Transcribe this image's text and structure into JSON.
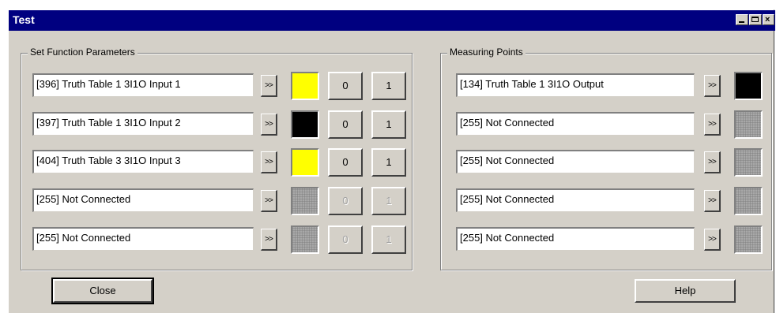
{
  "window": {
    "title": "Test",
    "controls": [
      "minimize-icon",
      "maximize-icon",
      "close-icon"
    ]
  },
  "colors": {
    "title_bar": "#000080",
    "yellow": "#ffff00",
    "black": "#000000"
  },
  "set_function": {
    "legend": "Set Function Parameters",
    "rows": [
      {
        "name": "[396] Truth Table 1 3I1O Input 1",
        "arrow": ">>",
        "state": "yellow",
        "btn0": "0",
        "btn1": "1",
        "enabled": true
      },
      {
        "name": "[397] Truth Table 1 3I1O Input 2",
        "arrow": ">>",
        "state": "black",
        "btn0": "0",
        "btn1": "1",
        "enabled": true
      },
      {
        "name": "[404] Truth Table 3 3I1O Input 3",
        "arrow": ">>",
        "state": "yellow",
        "btn0": "0",
        "btn1": "1",
        "enabled": true
      },
      {
        "name": "[255] Not Connected",
        "arrow": ">>",
        "state": "disabled",
        "btn0": "0",
        "btn1": "1",
        "enabled": false
      },
      {
        "name": "[255] Not Connected",
        "arrow": ">>",
        "state": "disabled",
        "btn0": "0",
        "btn1": "1",
        "enabled": false
      }
    ]
  },
  "measuring": {
    "legend": "Measuring Points",
    "rows": [
      {
        "name": "[134] Truth Table 1 3I1O Output",
        "arrow": ">>",
        "state": "black"
      },
      {
        "name": "[255] Not Connected",
        "arrow": ">>",
        "state": "disabled"
      },
      {
        "name": "[255] Not Connected",
        "arrow": ">>",
        "state": "disabled"
      },
      {
        "name": "[255] Not Connected",
        "arrow": ">>",
        "state": "disabled"
      },
      {
        "name": "[255] Not Connected",
        "arrow": ">>",
        "state": "disabled"
      }
    ]
  },
  "buttons": {
    "close": "Close",
    "help": "Help"
  }
}
